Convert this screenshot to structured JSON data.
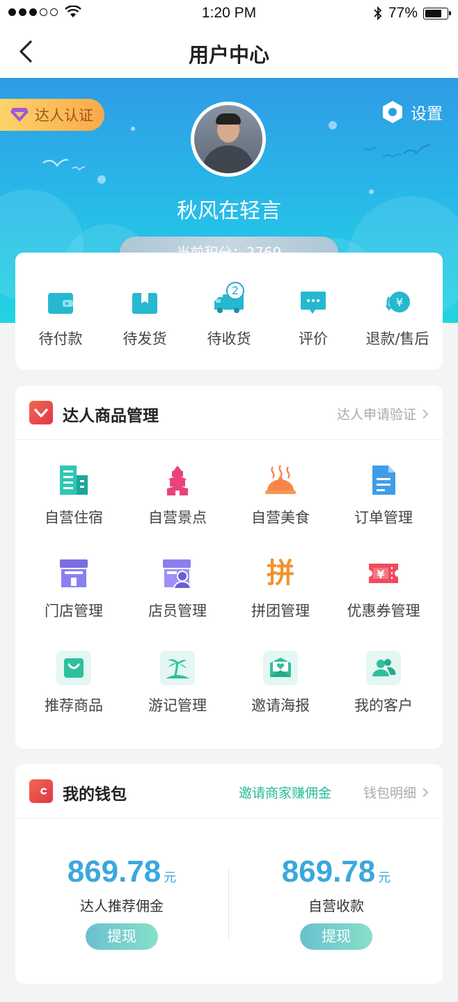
{
  "status": {
    "time": "1:20 PM",
    "battery": "77%"
  },
  "nav": {
    "title": "用户中心"
  },
  "profile": {
    "badge": "达人认证",
    "settings": "设置",
    "username": "秋风在轻言",
    "points": "当前积分：2769"
  },
  "orders": [
    {
      "label": "待付款",
      "icon": "wallet-icon"
    },
    {
      "label": "待发货",
      "icon": "package-icon"
    },
    {
      "label": "待收货",
      "icon": "truck-icon",
      "count": "2"
    },
    {
      "label": "评价",
      "icon": "comment-icon"
    },
    {
      "label": "退款/售后",
      "icon": "refund-icon"
    }
  ],
  "goods": {
    "title": "达人商品管理",
    "link": "达人申请验证",
    "items": [
      {
        "label": "自营住宿",
        "icon": "building-icon"
      },
      {
        "label": "自营景点",
        "icon": "pagoda-icon"
      },
      {
        "label": "自营美食",
        "icon": "food-cloche-icon"
      },
      {
        "label": "订单管理",
        "icon": "document-icon"
      },
      {
        "label": "门店管理",
        "icon": "store-icon"
      },
      {
        "label": "店员管理",
        "icon": "staff-icon"
      },
      {
        "label": "拼团管理",
        "icon": "group-buy-icon",
        "glyph": "拼"
      },
      {
        "label": "优惠券管理",
        "icon": "coupon-icon"
      },
      {
        "label": "推荐商品",
        "icon": "shopping-bag-icon"
      },
      {
        "label": "游记管理",
        "icon": "island-icon"
      },
      {
        "label": "邀请海报",
        "icon": "poster-icon"
      },
      {
        "label": "我的客户",
        "icon": "customers-icon"
      }
    ]
  },
  "wallet": {
    "title": "我的钱包",
    "invite": "邀请商家赚佣金",
    "link": "钱包明细",
    "left": {
      "amount": "869.78",
      "unit": "元",
      "label": "达人推荐佣金",
      "button": "提现"
    },
    "right": {
      "amount": "869.78",
      "unit": "元",
      "label": "自营收款",
      "button": "提现"
    }
  },
  "colors": {
    "accent": "#3aa8dc",
    "green": "#25b99b",
    "heroTop": "#2f9be6",
    "heroBottom": "#22d4e2"
  }
}
